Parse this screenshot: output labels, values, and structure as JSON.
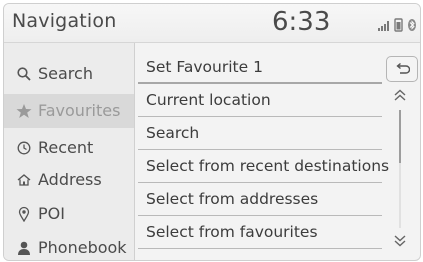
{
  "header": {
    "title": "Navigation",
    "clock": "6:33",
    "status_icons": [
      "signal-bars-icon",
      "phone-battery-icon",
      "bluetooth-icon"
    ]
  },
  "sidebar": {
    "items": [
      {
        "label": "Search",
        "icon": "search-icon"
      },
      {
        "label": "Favourites",
        "icon": "star-icon",
        "active": true
      },
      {
        "label": "Recent",
        "icon": "clock-icon"
      },
      {
        "label": "Address",
        "icon": "house-icon"
      },
      {
        "label": "POI",
        "icon": "location-pin-icon"
      },
      {
        "label": "Phonebook",
        "icon": "person-icon"
      }
    ]
  },
  "list": {
    "rows": [
      {
        "label": "Set Favourite 1"
      },
      {
        "label": "Current location"
      },
      {
        "label": "Search"
      },
      {
        "label": "Select from recent destinations"
      },
      {
        "label": "Select from addresses"
      },
      {
        "label": "Select from favourites"
      }
    ]
  },
  "controls": {
    "back": "back-arrow-icon",
    "scroll_up": "double-chevron-up-icon",
    "scroll_down": "double-chevron-down-icon",
    "scroll_position": 0.0,
    "scroll_visible_fraction": 0.45
  },
  "colors": {
    "background": "#f3f3f3",
    "active_item": "#d9d9d9",
    "text": "#3c3c3c"
  }
}
